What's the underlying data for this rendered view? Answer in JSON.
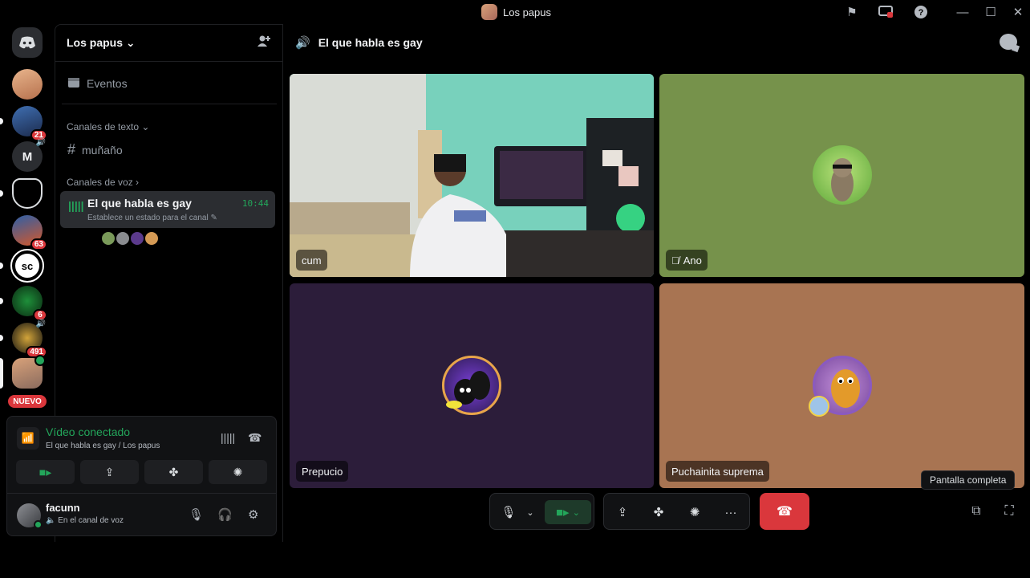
{
  "window": {
    "title": "Los papus"
  },
  "servers": {
    "badges": [
      "21",
      "63",
      "6",
      "491"
    ],
    "new_label": "NUEVO"
  },
  "sidebar": {
    "server_name": "Los papus",
    "events_label": "Eventos",
    "text_category": "Canales de texto",
    "text_channels": [
      "muñaño"
    ],
    "voice_category": "Canales de voz",
    "voice_channel": {
      "name": "El que habla es gay",
      "status_placeholder": "Establece un estado para el canal",
      "duration": "10:44"
    }
  },
  "voice_panel": {
    "status": "Vídeo conectado",
    "location": "El que habla es gay / Los papus",
    "username": "facunn",
    "user_status": "En el canal de voz"
  },
  "main": {
    "channel_title": "El que habla es gay",
    "participants": [
      {
        "name": "cum",
        "kind": "camera"
      },
      {
        "name": "Ano",
        "kind": "avatar",
        "muted": true
      },
      {
        "name": "Prepucio",
        "kind": "avatar"
      },
      {
        "name": "Puchainita suprema",
        "kind": "avatar"
      }
    ],
    "tooltip": "Pantalla completa"
  },
  "colors": {
    "accent_green": "#23a55a",
    "danger_red": "#da373c",
    "tile_ano": "#76924b",
    "tile_prepucio": "#2c1d3a",
    "tile_puchainita": "#a87452"
  }
}
